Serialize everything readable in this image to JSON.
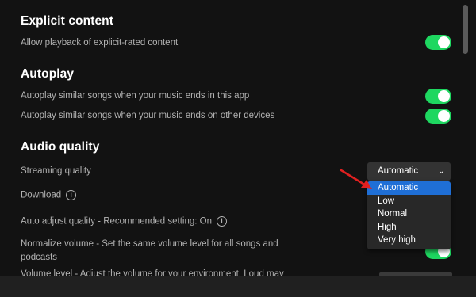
{
  "sections": {
    "explicit": {
      "title": "Explicit content",
      "rows": [
        {
          "label": "Allow playback of explicit-rated content",
          "on": true
        }
      ]
    },
    "autoplay": {
      "title": "Autoplay",
      "rows": [
        {
          "label": "Autoplay similar songs when your music ends in this app",
          "on": true
        },
        {
          "label": "Autoplay similar songs when your music ends on other devices",
          "on": true
        }
      ]
    },
    "audio": {
      "title": "Audio quality",
      "streaming_label": "Streaming quality",
      "download_label": "Download",
      "auto_adjust_label": "Auto adjust quality - Recommended setting: On",
      "normalize_label_line1": "Normalize volume - Set the same volume level for all songs and",
      "normalize_label_line2": "podcasts",
      "volume_level_label": "Volume level - Adjust the volume for your environment. Loud may"
    }
  },
  "streaming_quality": {
    "selected": "Automatic",
    "options": [
      "Automatic",
      "Low",
      "Normal",
      "High",
      "Very high"
    ]
  },
  "icons": {
    "info": "i",
    "chevron": "⌄"
  },
  "colors": {
    "background": "#121212",
    "toggle_on": "#1ed760",
    "highlight": "#1f6fd6",
    "annotation_arrow": "#e02020"
  }
}
